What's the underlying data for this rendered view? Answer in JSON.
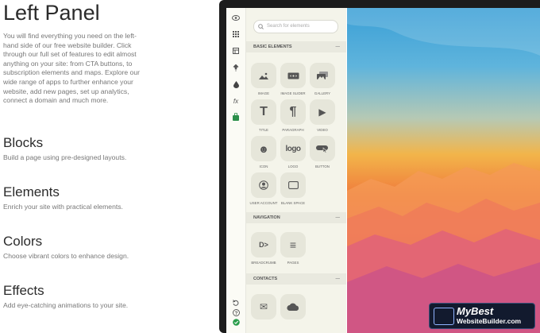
{
  "left": {
    "title": "Left Panel",
    "intro": "You will find everything you need on the left-hand side of our free website builder. Click through our full set of features to edit almost anything on your site: from CTA buttons, to subscription elements and maps. Explore our wide range of apps to further enhance your website, add new pages, set up analytics, connect a domain and much more.",
    "features": [
      {
        "title": "Blocks",
        "desc": "Build a page using pre-designed layouts."
      },
      {
        "title": "Elements",
        "desc": "Enrich your site with practical elements."
      },
      {
        "title": "Colors",
        "desc": "Choose vibrant colors to enhance design."
      },
      {
        "title": "Effects",
        "desc": "Add eye-catching animations to your site."
      }
    ]
  },
  "editor": {
    "search_placeholder": "Search for elements",
    "sections": [
      {
        "title": "BASIC ELEMENTS",
        "toggle": "—"
      },
      {
        "title": "NAVIGATION",
        "toggle": "—"
      },
      {
        "title": "CONTACTS",
        "toggle": "—"
      }
    ],
    "tiles": [
      {
        "label": "IMAGE",
        "icon": "image-icon"
      },
      {
        "label": "IMAGE SLIDER",
        "icon": "image-slider-icon"
      },
      {
        "label": "GALLERY",
        "icon": "gallery-icon"
      },
      {
        "label": "TITLE",
        "icon": "title-icon"
      },
      {
        "label": "PARAGRAPH",
        "icon": "paragraph-icon"
      },
      {
        "label": "VIDEO",
        "icon": "video-icon"
      },
      {
        "label": "ICON",
        "icon": "smiley-icon"
      },
      {
        "label": "LOGO",
        "icon": "logo-icon"
      },
      {
        "label": "BUTTON",
        "icon": "button-icon"
      },
      {
        "label": "USER ACCOUNT",
        "icon": "user-account-icon"
      },
      {
        "label": "BLANK SPACE",
        "icon": "blank-space-icon"
      },
      {
        "label": "BREADCRUMB",
        "icon": "breadcrumb-icon"
      },
      {
        "label": "PAGES",
        "icon": "pages-icon"
      },
      {
        "label": "",
        "icon": "email-icon"
      },
      {
        "label": "",
        "icon": "cloud-icon"
      }
    ],
    "tile_glyphs": {
      "title": "T",
      "paragraph": "¶",
      "video": "▶",
      "logo": "logo",
      "breadcrumb": "D>",
      "pages": "≡",
      "email": "✉",
      "smiley": "☻"
    },
    "iconbar": [
      "eye-icon",
      "grid-icon",
      "layout-icon",
      "pin-icon",
      "drop-icon",
      "fx-icon",
      "bag-icon",
      "undo-icon",
      "help-icon",
      "check-icon"
    ],
    "iconbar_glyphs": {
      "fx": "fx",
      "help": "?"
    }
  },
  "watermark": {
    "line1": "MyBest",
    "line2": "WebsiteBuilder.com"
  },
  "colors": {
    "panel_bg": "#f4f4ea",
    "tile_bg": "#e6e6da",
    "check_green": "#2a9d4b",
    "bag_green": "#2b8f4a"
  }
}
